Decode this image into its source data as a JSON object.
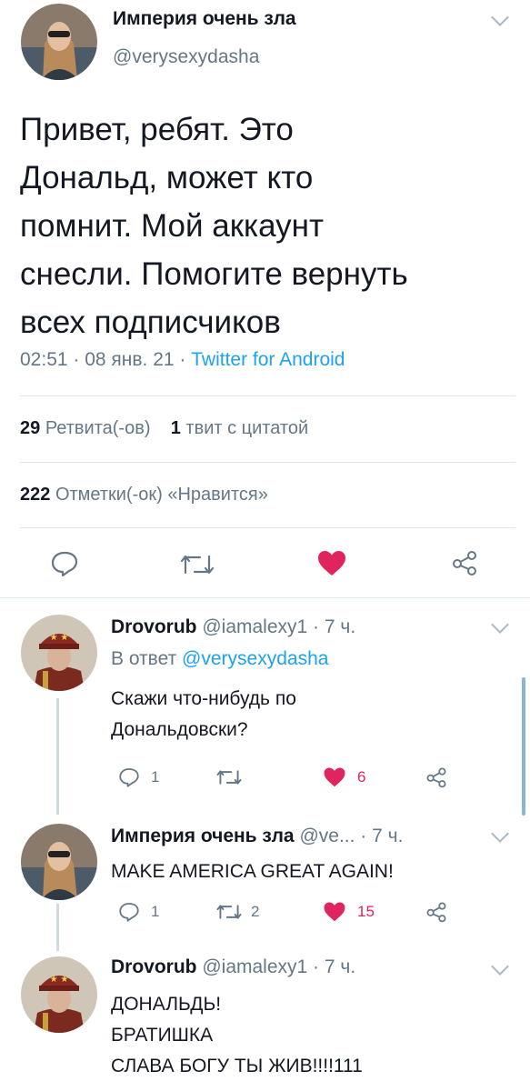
{
  "main_tweet": {
    "name": "Империя очень зла",
    "handle": "@verysexydasha",
    "text_lines": [
      "Привет, ребят. Это",
      "Дональд, может кто",
      "помнит. Мой аккаунт",
      "снесли. Помогите вернуть",
      "всех подписчиков"
    ],
    "meta_time": "02:51 · 08 янв. 21 ·",
    "meta_source": "Twitter for Android",
    "retweets_count": "29",
    "retweets_label": "Ретвита(-ов)",
    "quotes_count": "1",
    "quotes_label": "твит с цитатой",
    "likes_count": "222",
    "likes_label": "Отметки(-ок) «Нравится»"
  },
  "replies": [
    {
      "name": "Drovorub",
      "handle_time": "@iamalexy1 · 7 ч.",
      "reply_prefix": "В ответ",
      "reply_to": "@verysexydasha",
      "text_lines": [
        "Скажи что-нибудь по",
        "Дональдовски?"
      ],
      "reply_count": "1",
      "retweet_count": "",
      "like_count": "6"
    },
    {
      "name": "Империя очень зла",
      "handle_time": "@ve... · 7 ч.",
      "text_lines": [
        "MAKE AMERICA GREAT AGAIN!"
      ],
      "reply_count": "1",
      "retweet_count": "2",
      "like_count": "15"
    },
    {
      "name": "Drovorub",
      "handle_time": "@iamalexy1 · 7 ч.",
      "text_lines": [
        "ДОНАЛЬДЬ!",
        "БРАТИШКА",
        "СЛАВА БОГУ ТЫ ЖИВ!!!!111"
      ]
    }
  ],
  "colors": {
    "like_red": "#e0245e",
    "link_blue": "#1da1f2",
    "secondary_gray": "#657786",
    "divider": "#e1e8ed"
  },
  "icons": [
    "reply-icon",
    "retweet-icon",
    "heart-icon",
    "share-icon",
    "chevron-down-icon"
  ]
}
